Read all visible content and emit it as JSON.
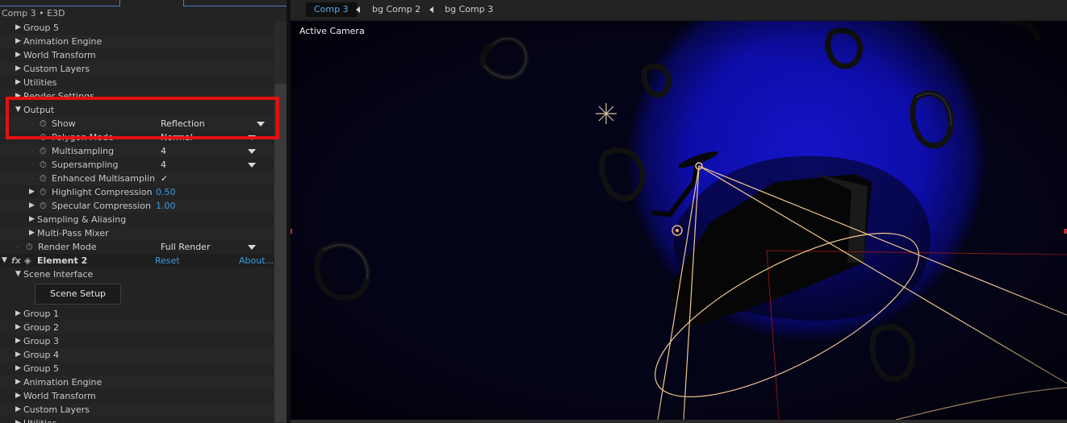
{
  "effects_panel": {
    "title": "Comp 3 • E3D",
    "rows_top": [
      {
        "label": "Group 5"
      },
      {
        "label": "Animation Engine"
      },
      {
        "label": "World Transform"
      },
      {
        "label": "Custom Layers"
      },
      {
        "label": "Utilities"
      },
      {
        "label": "Render Settings"
      }
    ],
    "output": {
      "label": "Output",
      "show_label": "Show",
      "show_value": "Reflection",
      "polygon_label": "Polygon Mode",
      "polygon_value": "Normal",
      "multisampling_label": "Multisampling",
      "multisampling_value": "4",
      "supersampling_label": "Supersampling",
      "supersampling_value": "4",
      "enhanced_label": "Enhanced Multisamplin",
      "enhanced_value": "✓",
      "highlight_label": "Highlight Compression",
      "highlight_value": "0.50",
      "specular_label": "Specular Compression",
      "specular_value": "1.00",
      "sampling_label": "Sampling & Aliasing",
      "multipass_label": "Multi-Pass Mixer"
    },
    "render_mode_label": "Render Mode",
    "render_mode_value": "Full Render",
    "element": {
      "fx_icon": "fx",
      "name": "Element 2",
      "reset": "Reset",
      "about": "About...",
      "scene_interface": "Scene Interface",
      "scene_setup": "Scene Setup",
      "groups": [
        {
          "label": "Group 1"
        },
        {
          "label": "Group 2"
        },
        {
          "label": "Group 3"
        },
        {
          "label": "Group 4"
        },
        {
          "label": "Group 5"
        },
        {
          "label": "Animation Engine"
        },
        {
          "label": "World Transform"
        },
        {
          "label": "Custom Layers"
        },
        {
          "label": "Utilities"
        }
      ]
    }
  },
  "composition": {
    "tabs": [
      {
        "label": "Comp 3",
        "active": true
      },
      {
        "label": "bg Comp 2",
        "active": false
      },
      {
        "label": "bg Comp 3",
        "active": false
      }
    ],
    "view_label": "Active Camera"
  },
  "colors": {
    "accent_blue": "#3b9be0",
    "highlight_red": "#e41010",
    "scene_blue": "#1010c0"
  }
}
